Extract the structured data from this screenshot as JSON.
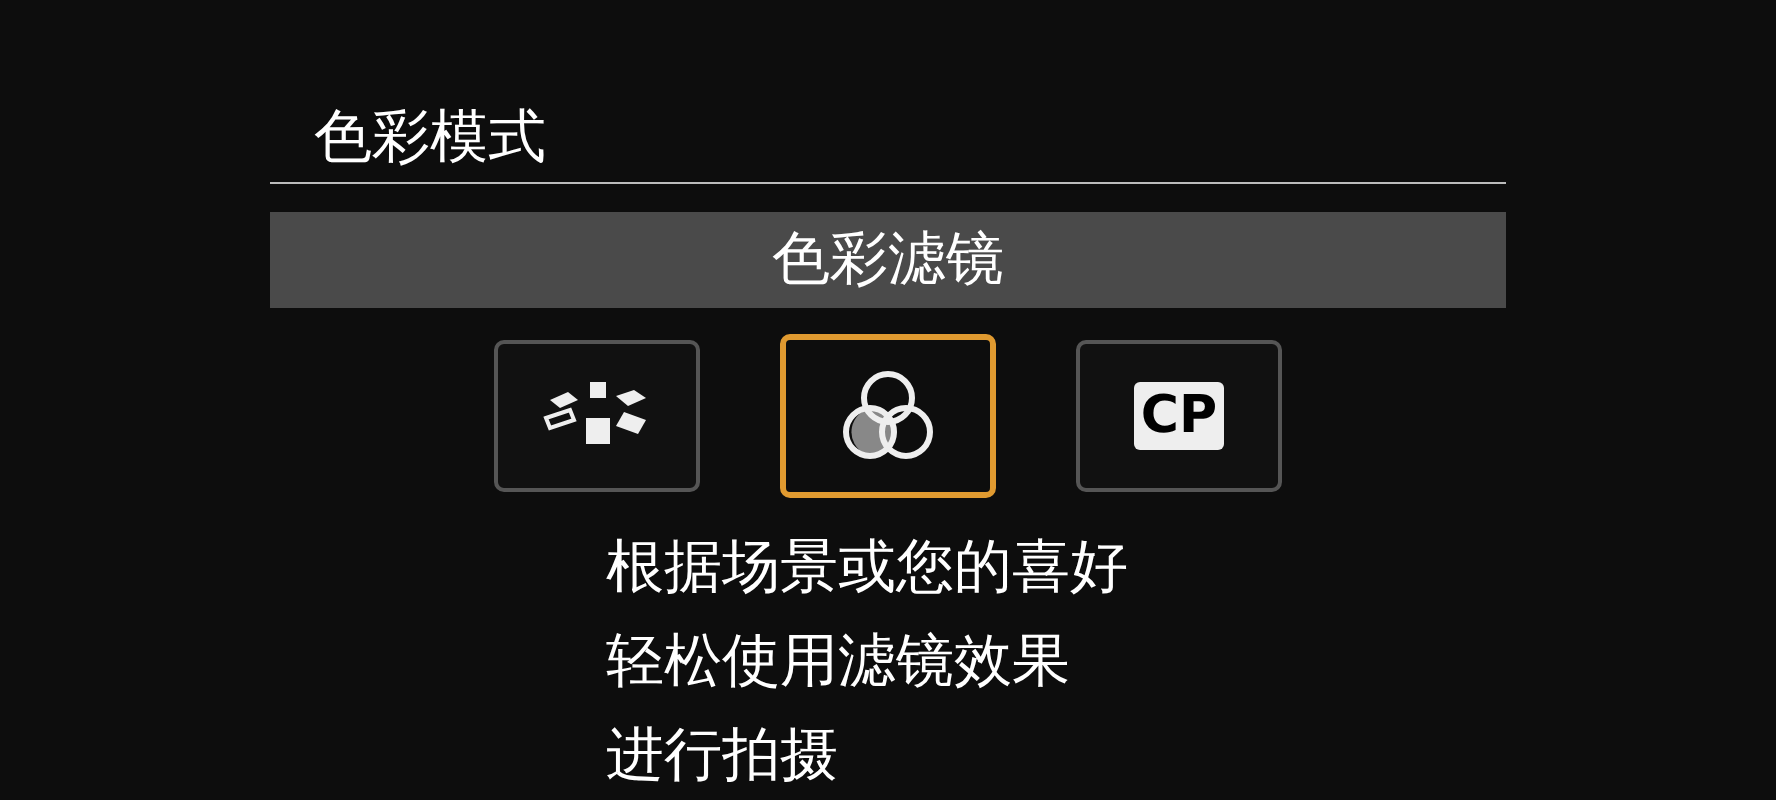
{
  "title": "色彩模式",
  "header": "色彩滤镜",
  "options": [
    {
      "kind": "styles",
      "selected": false
    },
    {
      "kind": "filter",
      "selected": true
    },
    {
      "kind": "cp",
      "label": "CP",
      "selected": false
    }
  ],
  "description": [
    "根据场景或您的喜好",
    "轻松使用滤镜效果",
    "进行拍摄"
  ]
}
